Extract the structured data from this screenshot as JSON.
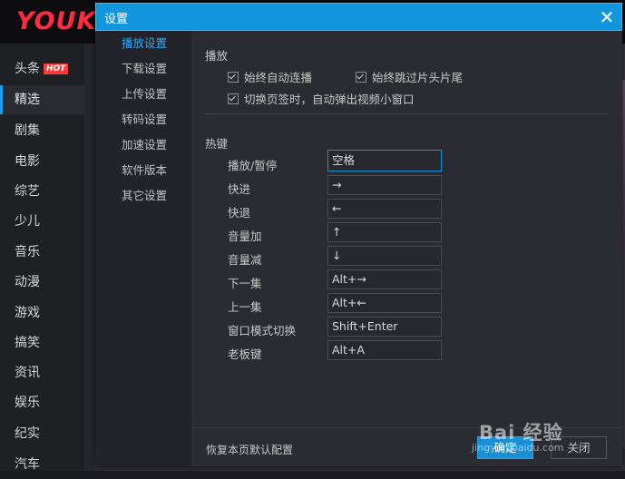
{
  "app": {
    "logo": "YOUK",
    "nav": [
      {
        "label": "头条",
        "badge": "HOT"
      },
      {
        "label": "精选",
        "active": true
      },
      {
        "label": "剧集"
      },
      {
        "label": "电影"
      },
      {
        "label": "综艺"
      },
      {
        "label": "少儿"
      },
      {
        "label": "音乐"
      },
      {
        "label": "动漫"
      },
      {
        "label": "游戏"
      },
      {
        "label": "搞笑"
      },
      {
        "label": "资讯"
      },
      {
        "label": "娱乐"
      },
      {
        "label": "纪实"
      },
      {
        "label": "汽车"
      }
    ]
  },
  "dialog": {
    "title": "设置",
    "close_icon": "close-icon",
    "menu": [
      "播放设置",
      "下载设置",
      "上传设置",
      "转码设置",
      "加速设置",
      "软件版本",
      "其它设置"
    ],
    "active_menu": "播放设置",
    "play_section": {
      "title": "播放",
      "options": [
        {
          "label": "始终自动连播",
          "checked": true
        },
        {
          "label": "始终跳过片头片尾",
          "checked": true
        },
        {
          "label": "切换页签时，自动弹出视频小窗口",
          "checked": true
        }
      ]
    },
    "hotkey_section": {
      "title": "热键",
      "items": [
        {
          "label": "播放/暂停",
          "value": "空格"
        },
        {
          "label": "快进",
          "value": "→"
        },
        {
          "label": "快退",
          "value": "←"
        },
        {
          "label": "音量加",
          "value": "↑"
        },
        {
          "label": "音量减",
          "value": "↓"
        },
        {
          "label": "下一集",
          "value": "Alt+→"
        },
        {
          "label": "上一集",
          "value": "Alt+←"
        },
        {
          "label": "窗口模式切换",
          "value": "Shift+Enter"
        },
        {
          "label": "老板键",
          "value": "Alt+A"
        }
      ]
    },
    "footer": {
      "reset_label": "恢复本页默认配置",
      "ok_label": "确定",
      "cancel_label": "关闭"
    }
  },
  "watermark": {
    "main": "Bai 经验",
    "sub": "jingyan.baidu.com"
  },
  "colors": {
    "accent": "#1296db",
    "active_menu": "#2fa8ff",
    "brand": "#ff2b41"
  }
}
